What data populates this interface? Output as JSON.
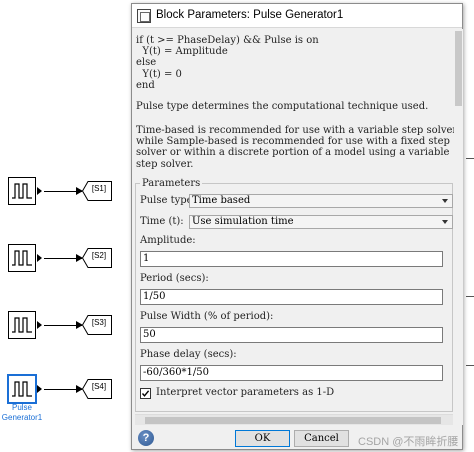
{
  "canvas": {
    "goto_tags": [
      "[S1]",
      "[S2]",
      "[S3]",
      "[S4]"
    ],
    "selected_block_name": [
      "Pulse",
      "Generator1"
    ]
  },
  "dialog": {
    "title": "Block Parameters: Pulse Generator1",
    "code_lines": "if (t >= PhaseDelay) && Pulse is on\n  Y(t) = Amplitude\nelse\n  Y(t) = 0\nend",
    "desc_p1": "Pulse type determines the computational technique used.",
    "desc_p2": "Time-based is recommended for use with a variable step solver,\nwhile Sample-based is recommended for use with a fixed step\nsolver or within a discrete portion of a model using a variable\nstep solver.",
    "group_title": "Parameters",
    "pulse_type": {
      "label": "Pulse type:",
      "value": "Time based"
    },
    "time": {
      "label": "Time (t):",
      "value": "Use simulation time"
    },
    "amplitude": {
      "label": "Amplitude:",
      "value": "1"
    },
    "period": {
      "label": "Period (secs):",
      "value": "1/50"
    },
    "pulse_width": {
      "label": "Pulse Width (% of period):",
      "value": "50"
    },
    "phase_delay": {
      "label": "Phase delay (secs):",
      "value": "-60/360*1/50"
    },
    "interpret_vector": {
      "label": "Interpret vector parameters as 1-D",
      "checked": true
    },
    "buttons": {
      "help_glyph": "?",
      "ok": "OK",
      "cancel": "Cancel"
    },
    "watermark": "CSDN @不雨眸折腰"
  }
}
